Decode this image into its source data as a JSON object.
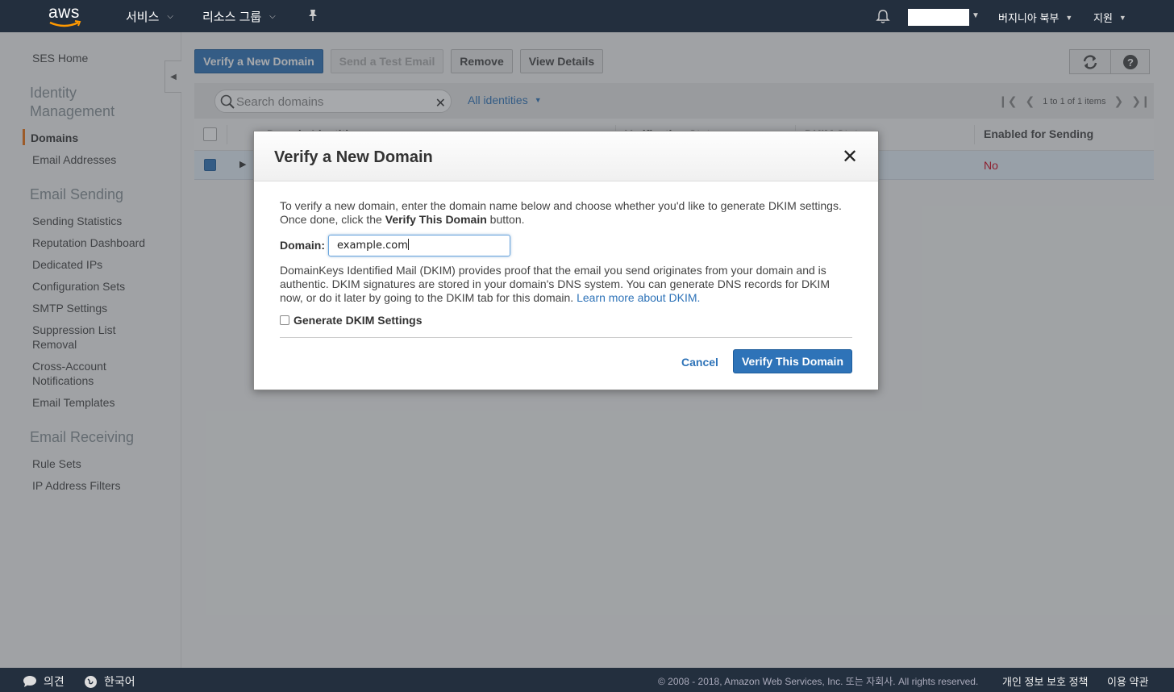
{
  "topnav": {
    "logo_text": "aws",
    "services": "서비스",
    "resource_groups": "리소스 그룹",
    "region": "버지니아 북부",
    "support": "지원"
  },
  "sidebar": {
    "home": "SES Home",
    "sections": [
      {
        "heading": "Identity Management",
        "items": [
          "Domains",
          "Email Addresses"
        ]
      },
      {
        "heading": "Email Sending",
        "items": [
          "Sending Statistics",
          "Reputation Dashboard",
          "Dedicated IPs",
          "Configuration Sets",
          "SMTP Settings",
          "Suppression List Removal",
          "Cross-Account Notifications",
          "Email Templates"
        ]
      },
      {
        "heading": "Email Receiving",
        "items": [
          "Rule Sets",
          "IP Address Filters"
        ]
      }
    ],
    "active_item": "Domains"
  },
  "toolbar": {
    "verify_new_domain": "Verify a New Domain",
    "send_test_email": "Send a Test Email",
    "remove": "Remove",
    "view_details": "View Details"
  },
  "filter": {
    "search_placeholder": "Search domains",
    "identity_filter": "All identities",
    "pagination": "1 to 1 of 1 items"
  },
  "table": {
    "columns": [
      "Domain Identities",
      "Verification Status",
      "DKIM Status",
      "Enabled for Sending"
    ],
    "rows": [
      {
        "enabled_for_sending": "No"
      }
    ]
  },
  "modal": {
    "title": "Verify a New Domain",
    "intro_1": "To verify a new domain, enter the domain name below and choose whether you'd like to generate DKIM settings. Once done, click the ",
    "intro_bold": "Verify This Domain",
    "intro_2": " button.",
    "domain_label": "Domain:",
    "domain_value": "example.com",
    "dkim_text": "DomainKeys Identified Mail (DKIM) provides proof that the email you send originates from your domain and is authentic. DKIM signatures are stored in your domain's DNS system. You can generate DNS records for DKIM now, or do it later by going to the DKIM tab for this domain. ",
    "dkim_link": "Learn more about DKIM",
    "dkim_period": ".",
    "generate_dkim_label": "Generate DKIM Settings",
    "generate_dkim_checked": false,
    "cancel": "Cancel",
    "verify": "Verify This Domain"
  },
  "footer": {
    "feedback": "의견",
    "language": "한국어",
    "copyright": "© 2008 - 2018, Amazon Web Services, Inc. 또는 자회사. All rights reserved.",
    "privacy": "개인 정보 보호 정책",
    "terms": "이용 약관"
  },
  "colors": {
    "nav_bg": "#232f3e",
    "primary": "#2e73b8",
    "accent": "#ec7211",
    "error": "#d0021b"
  }
}
